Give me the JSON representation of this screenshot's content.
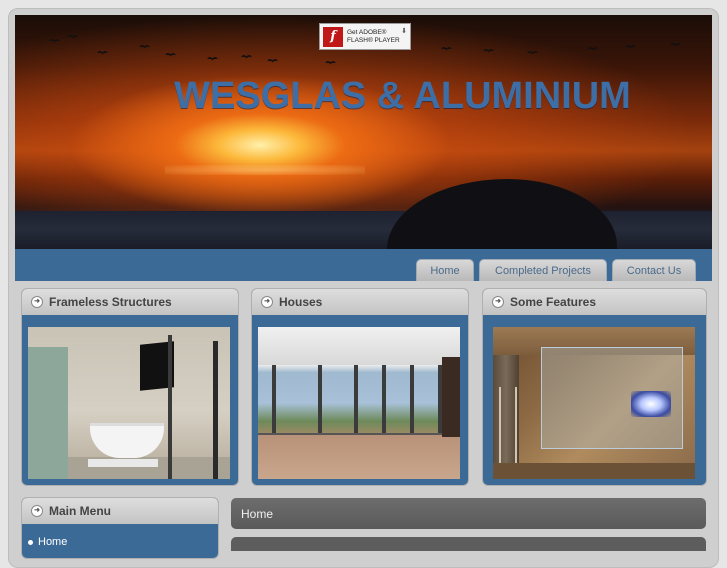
{
  "header": {
    "site_title": "WESGLAS & ALUMINIUM",
    "flash_badge": {
      "line1": "Get ADOBE®",
      "line2": "FLASH® PLAYER",
      "icon": "flash-icon"
    }
  },
  "nav": {
    "tabs": [
      {
        "label": "Home"
      },
      {
        "label": "Completed Projects"
      },
      {
        "label": "Contact Us"
      }
    ]
  },
  "modules": [
    {
      "title": "Frameless Structures",
      "icon": "arrow-circle-icon",
      "image": "frameless-bathroom-photo"
    },
    {
      "title": "Houses",
      "icon": "arrow-circle-icon",
      "image": "house-interior-photo"
    },
    {
      "title": "Some Features",
      "icon": "arrow-circle-icon",
      "image": "glass-feature-photo"
    }
  ],
  "main_menu": {
    "title": "Main Menu",
    "items": [
      {
        "label": "Home"
      }
    ]
  },
  "breadcrumb": {
    "current": "Home"
  },
  "colors": {
    "brand_blue": "#3c6a97",
    "title_blue": "#3d6ea6",
    "breadcrumb_bg": "#5f5f5f"
  }
}
